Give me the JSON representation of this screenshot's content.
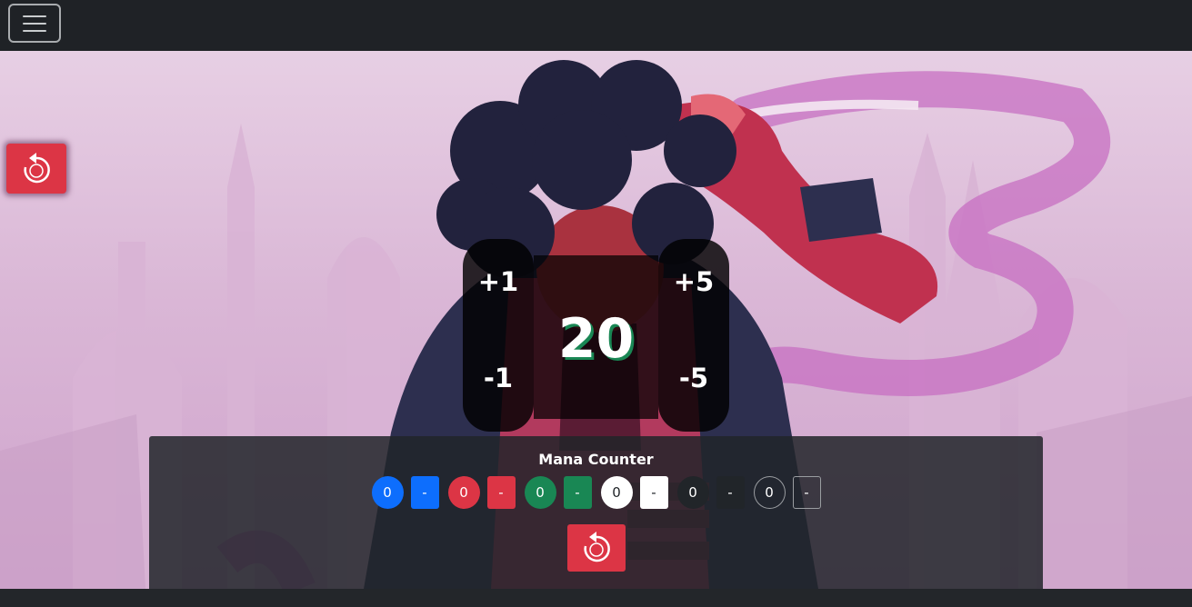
{
  "navbar": {
    "menu_icon": "hamburger-menu-icon"
  },
  "reset_button": {
    "icon": "reset-icon",
    "color": "#dc3545"
  },
  "life": {
    "total": "20",
    "plus_one": "+1",
    "minus_one": "-1",
    "plus_five": "+5",
    "minus_five": "-5",
    "shadow_color": "#198754"
  },
  "mana": {
    "title": "Mana Counter",
    "counters": [
      {
        "value": "0",
        "minus": "-",
        "color": "#0d6efd",
        "text_color": "#ffffff"
      },
      {
        "value": "0",
        "minus": "-",
        "color": "#dc3545",
        "text_color": "#ffffff"
      },
      {
        "value": "0",
        "minus": "-",
        "color": "#198754",
        "text_color": "#ffffff"
      },
      {
        "value": "0",
        "minus": "-",
        "color": "#ffffff",
        "text_color": "#212529"
      },
      {
        "value": "0",
        "minus": "-",
        "color": "#212529",
        "text_color": "#ffffff"
      },
      {
        "value": "0",
        "minus": "-",
        "color": "transparent",
        "text_color": "#ffffff"
      }
    ],
    "reset_icon": "reset-icon"
  }
}
